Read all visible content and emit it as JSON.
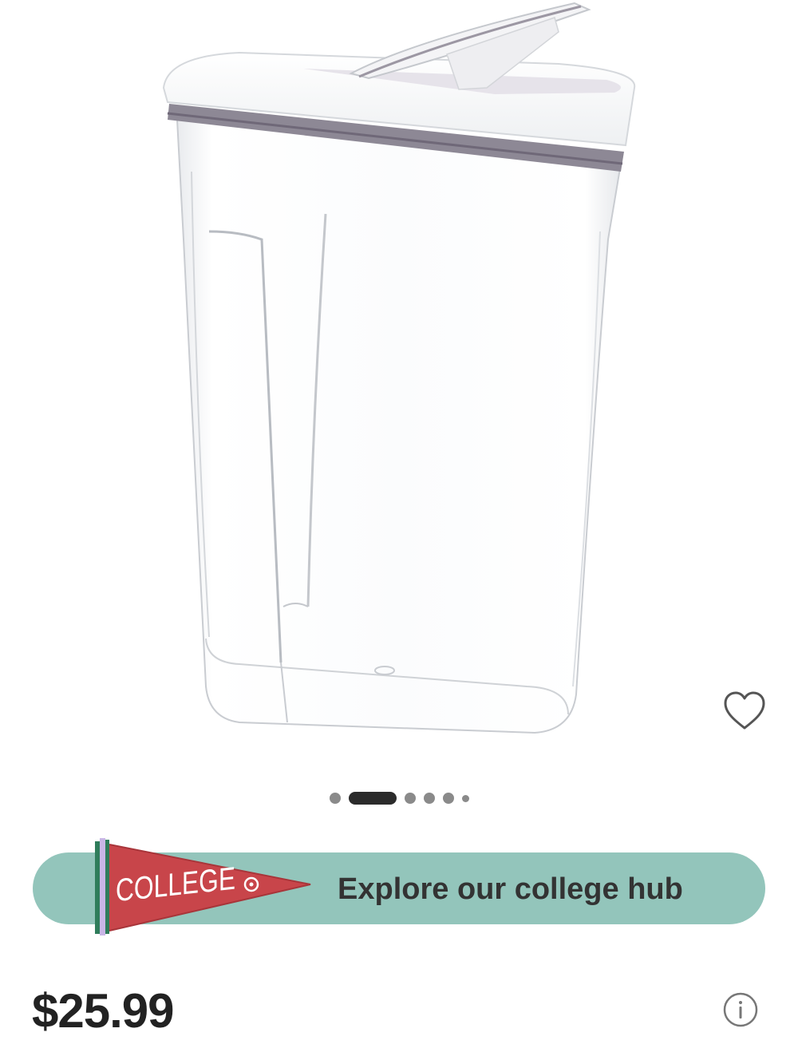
{
  "product": {
    "image_alt": "Clear plastic cereal dispenser container with white flip-top lid",
    "favorite_icon": "heart-outline-icon"
  },
  "carousel": {
    "total_dots": 6,
    "active_index": 1
  },
  "college_banner": {
    "pennant_text": "COLLEGE",
    "cta_text": "Explore our college hub",
    "background_color": "#93c5bb",
    "pennant_color": "#c8454a"
  },
  "pricing": {
    "price": "$25.99",
    "info_icon": "info-circle-icon"
  }
}
